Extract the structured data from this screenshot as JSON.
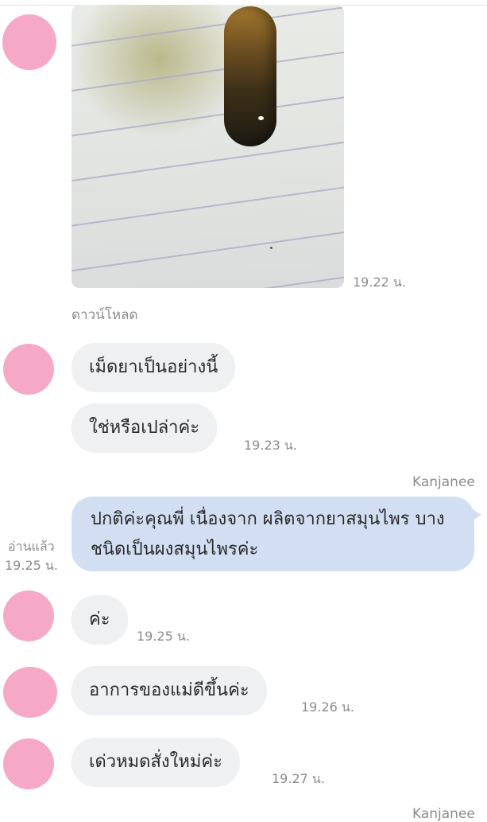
{
  "chat": {
    "image_message": {
      "time": "19.22 น.",
      "download_label": "ดาวน์โหลด"
    },
    "messages": [
      {
        "from": "them",
        "text": "เม็ดยาเป็นอย่างนี้"
      },
      {
        "from": "them",
        "text": "ใช่หรือเปล่าค่ะ",
        "time": "19.23 น."
      },
      {
        "from": "me",
        "sender": "Kanjanee",
        "text": "ปกติค่ะคุณพี่ เนื่องจาก ผลิตจากยาสมุนไพร บางชนิดเป็นผงสมุนไพรค่ะ",
        "read_label": "อ่านแล้ว",
        "time": "19.25 น."
      },
      {
        "from": "them",
        "text": "ค่ะ",
        "time": "19.25 น."
      },
      {
        "from": "them",
        "text": "อาการของแม่ดีขึ้นค่ะ",
        "time": "19.26 น."
      },
      {
        "from": "them",
        "text": "เด่วหมดสั่งใหม่ค่ะ",
        "time": "19.27 น."
      }
    ],
    "next_sender": "Kanjanee"
  },
  "colors": {
    "their_bubble": "#eef0f2",
    "my_bubble": "#d2dff3",
    "avatar": "#f6a9c7",
    "meta_text": "#8c8c8c"
  }
}
